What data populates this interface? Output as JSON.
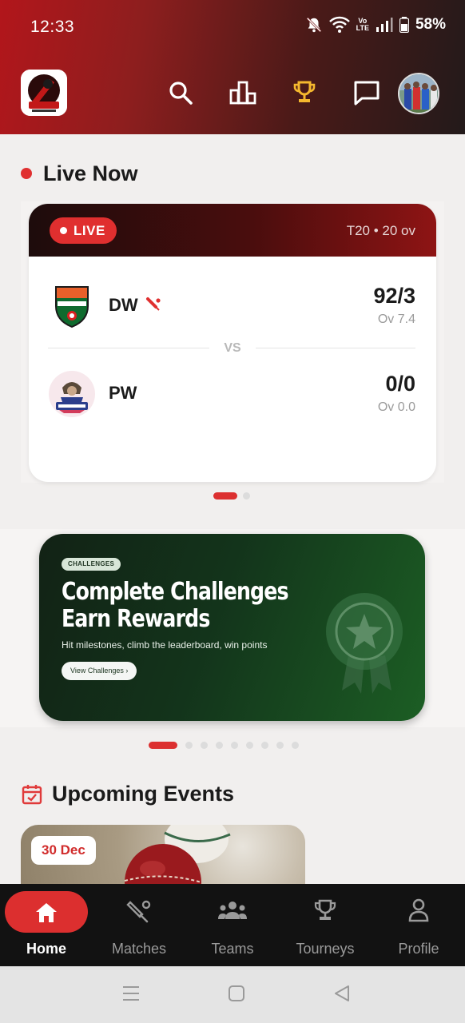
{
  "status_bar": {
    "time": "12:33",
    "battery": "58%",
    "volte": "Vo\nLTE"
  },
  "header": {
    "icons": [
      "search-icon",
      "leaderboard-icon",
      "trophy-icon",
      "chat-icon"
    ],
    "accent_trophy": "#f5b82e"
  },
  "live": {
    "title": "Live Now",
    "badge": "LIVE",
    "format": "T20 • 20 ov",
    "vs": "VS",
    "teams": [
      {
        "name": "DW",
        "score": "92/3",
        "overs": "Ov 7.4",
        "batting": true
      },
      {
        "name": "PW",
        "score": "0/0",
        "overs": "Ov 0.0",
        "batting": false
      }
    ]
  },
  "challenges": {
    "tag": "CHALLENGES",
    "title_line1": "Complete Challenges",
    "title_line2": "Earn Rewards",
    "subtitle": "Hit milestones, climb the leaderboard, win points",
    "button": "View Challenges ›"
  },
  "upcoming": {
    "title": "Upcoming Events",
    "first_event_date": "30 Dec"
  },
  "bottom_nav": [
    {
      "label": "Home",
      "icon": "home-icon",
      "active": true
    },
    {
      "label": "Matches",
      "icon": "cricket-bat-icon",
      "active": false
    },
    {
      "label": "Teams",
      "icon": "group-icon",
      "active": false
    },
    {
      "label": "Tourneys",
      "icon": "trophy-icon",
      "active": false
    },
    {
      "label": "Profile",
      "icon": "person-icon",
      "active": false
    }
  ],
  "colors": {
    "brand_red": "#dc2f2f",
    "header_dark": "#231a1a",
    "banner_green": "#1c5e24"
  }
}
